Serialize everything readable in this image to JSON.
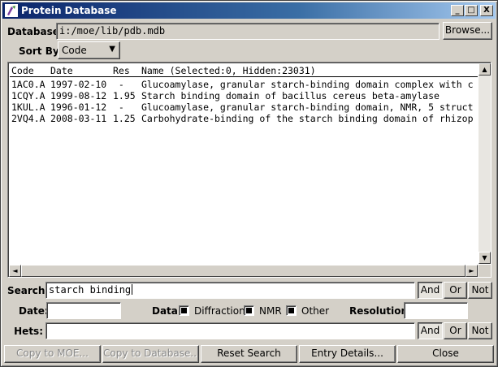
{
  "window": {
    "title": "Protein Database"
  },
  "title_buttons": {
    "minimize": "_",
    "maximize": "□",
    "close": "X"
  },
  "database": {
    "label": "Database:",
    "value": "i:/moe/lib/pdb.mdb",
    "browse": "Browse..."
  },
  "sort": {
    "label": "Sort By:",
    "value": "Code"
  },
  "table": {
    "columns": [
      "Code",
      "Date",
      "Res",
      "Name (Selected:0, Hidden:23031)"
    ],
    "rows": [
      [
        "1AC0.A",
        "1997-02-10",
        " -",
        "Glucoamylase, granular starch-binding domain complex with c"
      ],
      [
        "1CQY.A",
        "1999-08-12",
        "1.95",
        "Starch binding domain of bacillus cereus beta-amylase"
      ],
      [
        "1KUL.A",
        "1996-01-12",
        " -",
        "Glucoamylase, granular starch-binding domain, NMR, 5 struct"
      ],
      [
        "2VQ4.A",
        "2008-03-11",
        "1.25",
        "Carbohydrate-binding of the starch binding domain of rhizop"
      ]
    ]
  },
  "search": {
    "label": "Search:",
    "value": "starch binding",
    "and": "And",
    "or": "Or",
    "not": "Not"
  },
  "filters": {
    "date_label": "Date:",
    "date_value": "",
    "data_label": "Data:",
    "diffraction": "Diffraction",
    "nmr": "NMR",
    "other": "Other",
    "resolution_label": "Resolution:",
    "resolution_value": ""
  },
  "hets": {
    "label": "Hets:",
    "value": "",
    "and": "And",
    "or": "Or",
    "not": "Not"
  },
  "footer": {
    "copy_moe": "Copy to MOE...",
    "copy_db": "Copy to Database...",
    "reset": "Reset Search",
    "details": "Entry Details...",
    "close": "Close"
  },
  "colors": {
    "title_active": "#0a246a",
    "face": "#d4d0c8"
  }
}
